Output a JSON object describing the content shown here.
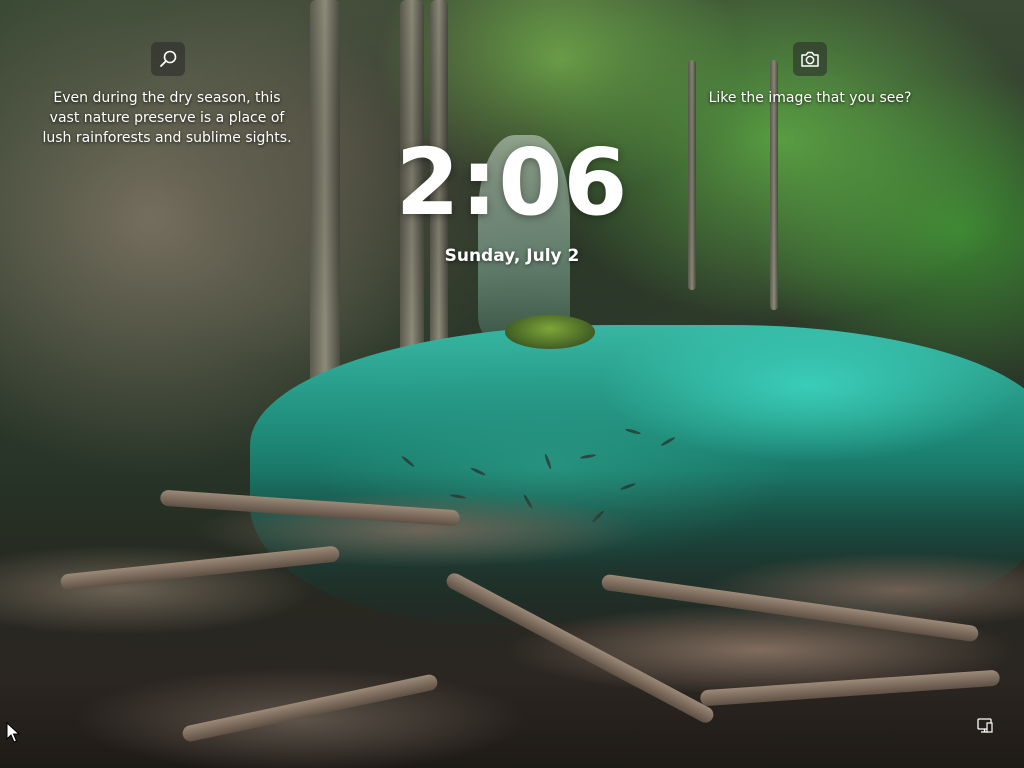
{
  "lockscreen": {
    "image_description": "Even during the dry season, this vast nature preserve is a place of lush rainforests and sublime sights.",
    "like_prompt": "Like the image that you see?",
    "time": "2:06",
    "date": "Sunday, July 2"
  },
  "icons": {
    "info_search": "search-icon",
    "info_camera": "camera-icon",
    "network_status": "network-icon",
    "pointer": "mouse-pointer-icon"
  },
  "colors": {
    "text": "#ffffff",
    "icon_button_bg": "#282828"
  }
}
